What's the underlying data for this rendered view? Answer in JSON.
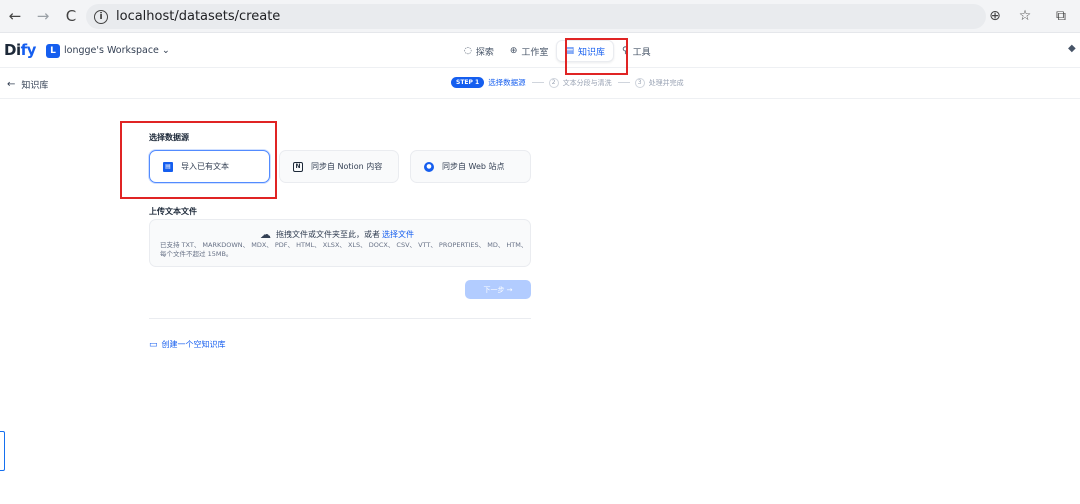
{
  "browser": {
    "url": "localhost/datasets/create",
    "back_icon": "←",
    "forward_icon": "→",
    "reload_icon": "C",
    "info_icon": "i",
    "zoom_icon": "⊕",
    "star_icon": "☆",
    "ext_icon": "⧉"
  },
  "header": {
    "logo_main": "Di",
    "logo_accent": "fy",
    "workspace_badge": "L",
    "workspace_name": "longge's Workspace ⌄",
    "nav": [
      {
        "icon": "◌",
        "label": "探索"
      },
      {
        "icon": "⊕",
        "label": "工作室"
      },
      {
        "icon": "▤",
        "label": "知识库",
        "active": true
      },
      {
        "icon": "⚲",
        "label": "工具"
      }
    ],
    "right_icon": "◆"
  },
  "steps": {
    "back_label": "知识库",
    "back_icon": "←",
    "step1_badge": "STEP 1",
    "step1_label": "选择数据源",
    "step2_num": "2",
    "step2_label": "文本分段与清洗",
    "step3_num": "3",
    "step3_label": "处理并完成"
  },
  "main": {
    "source_title": "选择数据源",
    "sources": [
      {
        "icon": "▤",
        "label": "导入已有文本",
        "active": true
      },
      {
        "icon": "N",
        "label": "同步自 Notion 内容"
      },
      {
        "icon": "●",
        "label": "同步自 Web 站点"
      }
    ],
    "upload_title": "上传文本文件",
    "upload_cloud": "☁",
    "upload_text": "拖拽文件或文件夹至此，或者",
    "upload_link": "选择文件",
    "upload_hint": "已支持 TXT、 MARKDOWN、 MDX、 PDF、 HTML、 XLSX、 XLS、 DOCX、 CSV、 VTT、 PROPERTIES、 MD、 HTM、每个文件不超过 15MB。",
    "next_button": "下一步 →",
    "create_empty_icon": "▭",
    "create_empty_label": "创建一个空知识库"
  }
}
